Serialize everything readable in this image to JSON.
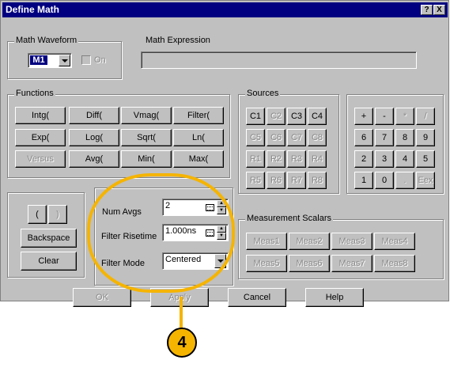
{
  "window": {
    "title": "Define Math",
    "help_btn": "?",
    "close_btn": "X"
  },
  "math_waveform": {
    "group_label": "Math Waveform",
    "selected": "M1",
    "on_label": "On"
  },
  "math_expression": {
    "label": "Math Expression",
    "value": ""
  },
  "functions": {
    "group_label": "Functions",
    "buttons": [
      "Intg(",
      "Diff(",
      "Vmag(",
      "Filter(",
      "Exp(",
      "Log(",
      "Sqrt(",
      "Ln(",
      "Versus",
      "Avg(",
      "Min(",
      "Max("
    ]
  },
  "sources": {
    "group_label": "Sources",
    "buttons": [
      "C1",
      "C2",
      "C3",
      "C4",
      "C5",
      "C6",
      "C7",
      "C8",
      "R1",
      "R2",
      "R3",
      "R4",
      "R5",
      "R6",
      "R7",
      "R8"
    ]
  },
  "keypad": {
    "buttons": [
      "+",
      "-",
      "*",
      "/",
      "6",
      "7",
      "8",
      "9",
      "2",
      "3",
      "4",
      "5",
      "1",
      "0",
      ".",
      "Eex"
    ]
  },
  "editing": {
    "open_paren": "(",
    "close_paren": ")",
    "backspace": "Backspace",
    "clear": "Clear"
  },
  "settings": {
    "num_avgs_label": "Num Avgs",
    "num_avgs_value": "2",
    "filter_risetime_label": "Filter Risetime",
    "filter_risetime_value": "1.000ns",
    "filter_mode_label": "Filter Mode",
    "filter_mode_value": "Centered"
  },
  "measurement_scalars": {
    "group_label": "Measurement Scalars",
    "buttons": [
      "Meas1",
      "Meas2",
      "Meas3",
      "Meas4",
      "Meas5",
      "Meas6",
      "Meas7",
      "Meas8"
    ]
  },
  "footer": {
    "ok": "OK",
    "apply": "Apply",
    "cancel": "Cancel",
    "help": "Help"
  },
  "callout": {
    "number": "4",
    "color": "#f5b400"
  },
  "colors": {
    "titlebar": "#000080",
    "face": "#c0c0c0",
    "selected_bg": "#000080"
  }
}
